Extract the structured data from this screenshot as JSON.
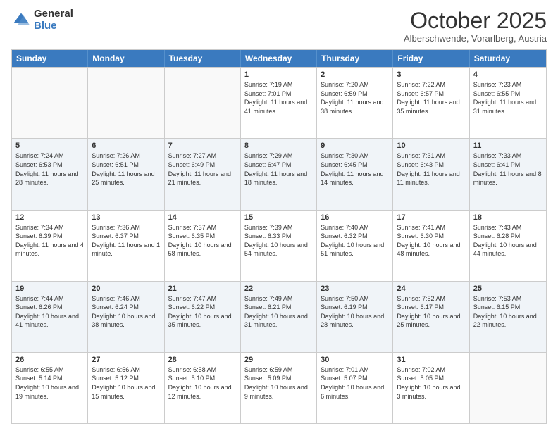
{
  "logo": {
    "general": "General",
    "blue": "Blue"
  },
  "title": "October 2025",
  "subtitle": "Alberschwende, Vorarlberg, Austria",
  "header_days": [
    "Sunday",
    "Monday",
    "Tuesday",
    "Wednesday",
    "Thursday",
    "Friday",
    "Saturday"
  ],
  "weeks": [
    [
      {
        "date": "",
        "sunrise": "",
        "sunset": "",
        "daylight": ""
      },
      {
        "date": "",
        "sunrise": "",
        "sunset": "",
        "daylight": ""
      },
      {
        "date": "",
        "sunrise": "",
        "sunset": "",
        "daylight": ""
      },
      {
        "date": "1",
        "sunrise": "Sunrise: 7:19 AM",
        "sunset": "Sunset: 7:01 PM",
        "daylight": "Daylight: 11 hours and 41 minutes."
      },
      {
        "date": "2",
        "sunrise": "Sunrise: 7:20 AM",
        "sunset": "Sunset: 6:59 PM",
        "daylight": "Daylight: 11 hours and 38 minutes."
      },
      {
        "date": "3",
        "sunrise": "Sunrise: 7:22 AM",
        "sunset": "Sunset: 6:57 PM",
        "daylight": "Daylight: 11 hours and 35 minutes."
      },
      {
        "date": "4",
        "sunrise": "Sunrise: 7:23 AM",
        "sunset": "Sunset: 6:55 PM",
        "daylight": "Daylight: 11 hours and 31 minutes."
      }
    ],
    [
      {
        "date": "5",
        "sunrise": "Sunrise: 7:24 AM",
        "sunset": "Sunset: 6:53 PM",
        "daylight": "Daylight: 11 hours and 28 minutes."
      },
      {
        "date": "6",
        "sunrise": "Sunrise: 7:26 AM",
        "sunset": "Sunset: 6:51 PM",
        "daylight": "Daylight: 11 hours and 25 minutes."
      },
      {
        "date": "7",
        "sunrise": "Sunrise: 7:27 AM",
        "sunset": "Sunset: 6:49 PM",
        "daylight": "Daylight: 11 hours and 21 minutes."
      },
      {
        "date": "8",
        "sunrise": "Sunrise: 7:29 AM",
        "sunset": "Sunset: 6:47 PM",
        "daylight": "Daylight: 11 hours and 18 minutes."
      },
      {
        "date": "9",
        "sunrise": "Sunrise: 7:30 AM",
        "sunset": "Sunset: 6:45 PM",
        "daylight": "Daylight: 11 hours and 14 minutes."
      },
      {
        "date": "10",
        "sunrise": "Sunrise: 7:31 AM",
        "sunset": "Sunset: 6:43 PM",
        "daylight": "Daylight: 11 hours and 11 minutes."
      },
      {
        "date": "11",
        "sunrise": "Sunrise: 7:33 AM",
        "sunset": "Sunset: 6:41 PM",
        "daylight": "Daylight: 11 hours and 8 minutes."
      }
    ],
    [
      {
        "date": "12",
        "sunrise": "Sunrise: 7:34 AM",
        "sunset": "Sunset: 6:39 PM",
        "daylight": "Daylight: 11 hours and 4 minutes."
      },
      {
        "date": "13",
        "sunrise": "Sunrise: 7:36 AM",
        "sunset": "Sunset: 6:37 PM",
        "daylight": "Daylight: 11 hours and 1 minute."
      },
      {
        "date": "14",
        "sunrise": "Sunrise: 7:37 AM",
        "sunset": "Sunset: 6:35 PM",
        "daylight": "Daylight: 10 hours and 58 minutes."
      },
      {
        "date": "15",
        "sunrise": "Sunrise: 7:39 AM",
        "sunset": "Sunset: 6:33 PM",
        "daylight": "Daylight: 10 hours and 54 minutes."
      },
      {
        "date": "16",
        "sunrise": "Sunrise: 7:40 AM",
        "sunset": "Sunset: 6:32 PM",
        "daylight": "Daylight: 10 hours and 51 minutes."
      },
      {
        "date": "17",
        "sunrise": "Sunrise: 7:41 AM",
        "sunset": "Sunset: 6:30 PM",
        "daylight": "Daylight: 10 hours and 48 minutes."
      },
      {
        "date": "18",
        "sunrise": "Sunrise: 7:43 AM",
        "sunset": "Sunset: 6:28 PM",
        "daylight": "Daylight: 10 hours and 44 minutes."
      }
    ],
    [
      {
        "date": "19",
        "sunrise": "Sunrise: 7:44 AM",
        "sunset": "Sunset: 6:26 PM",
        "daylight": "Daylight: 10 hours and 41 minutes."
      },
      {
        "date": "20",
        "sunrise": "Sunrise: 7:46 AM",
        "sunset": "Sunset: 6:24 PM",
        "daylight": "Daylight: 10 hours and 38 minutes."
      },
      {
        "date": "21",
        "sunrise": "Sunrise: 7:47 AM",
        "sunset": "Sunset: 6:22 PM",
        "daylight": "Daylight: 10 hours and 35 minutes."
      },
      {
        "date": "22",
        "sunrise": "Sunrise: 7:49 AM",
        "sunset": "Sunset: 6:21 PM",
        "daylight": "Daylight: 10 hours and 31 minutes."
      },
      {
        "date": "23",
        "sunrise": "Sunrise: 7:50 AM",
        "sunset": "Sunset: 6:19 PM",
        "daylight": "Daylight: 10 hours and 28 minutes."
      },
      {
        "date": "24",
        "sunrise": "Sunrise: 7:52 AM",
        "sunset": "Sunset: 6:17 PM",
        "daylight": "Daylight: 10 hours and 25 minutes."
      },
      {
        "date": "25",
        "sunrise": "Sunrise: 7:53 AM",
        "sunset": "Sunset: 6:15 PM",
        "daylight": "Daylight: 10 hours and 22 minutes."
      }
    ],
    [
      {
        "date": "26",
        "sunrise": "Sunrise: 6:55 AM",
        "sunset": "Sunset: 5:14 PM",
        "daylight": "Daylight: 10 hours and 19 minutes."
      },
      {
        "date": "27",
        "sunrise": "Sunrise: 6:56 AM",
        "sunset": "Sunset: 5:12 PM",
        "daylight": "Daylight: 10 hours and 15 minutes."
      },
      {
        "date": "28",
        "sunrise": "Sunrise: 6:58 AM",
        "sunset": "Sunset: 5:10 PM",
        "daylight": "Daylight: 10 hours and 12 minutes."
      },
      {
        "date": "29",
        "sunrise": "Sunrise: 6:59 AM",
        "sunset": "Sunset: 5:09 PM",
        "daylight": "Daylight: 10 hours and 9 minutes."
      },
      {
        "date": "30",
        "sunrise": "Sunrise: 7:01 AM",
        "sunset": "Sunset: 5:07 PM",
        "daylight": "Daylight: 10 hours and 6 minutes."
      },
      {
        "date": "31",
        "sunrise": "Sunrise: 7:02 AM",
        "sunset": "Sunset: 5:05 PM",
        "daylight": "Daylight: 10 hours and 3 minutes."
      },
      {
        "date": "",
        "sunrise": "",
        "sunset": "",
        "daylight": ""
      }
    ]
  ]
}
